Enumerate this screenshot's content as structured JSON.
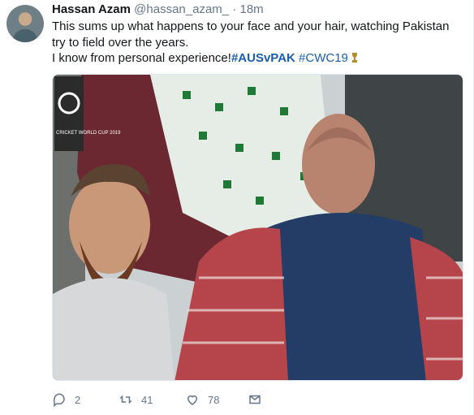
{
  "tweet": {
    "author_name": "Hassan Azam",
    "author_handle": "@hassan_azam_",
    "separator": "·",
    "time": "18m",
    "line1": "This sums up what happens to your face and your hair, watching Pakistan try to field over the years.",
    "line2_prefix": "I know from personal experience!",
    "hashtag1": "#AUSvPAK",
    "hashtag2": "#CWC19",
    "photo_logo_text": "CRICKET WORLD CUP 2019"
  },
  "actions": {
    "replies": "2",
    "retweets": "41",
    "likes": "78"
  },
  "colors": {
    "link": "#1b5ea8",
    "muted": "#657786",
    "text": "#14171a"
  },
  "icons": [
    "reply-icon",
    "retweet-icon",
    "like-icon",
    "message-icon",
    "trophy-icon"
  ]
}
